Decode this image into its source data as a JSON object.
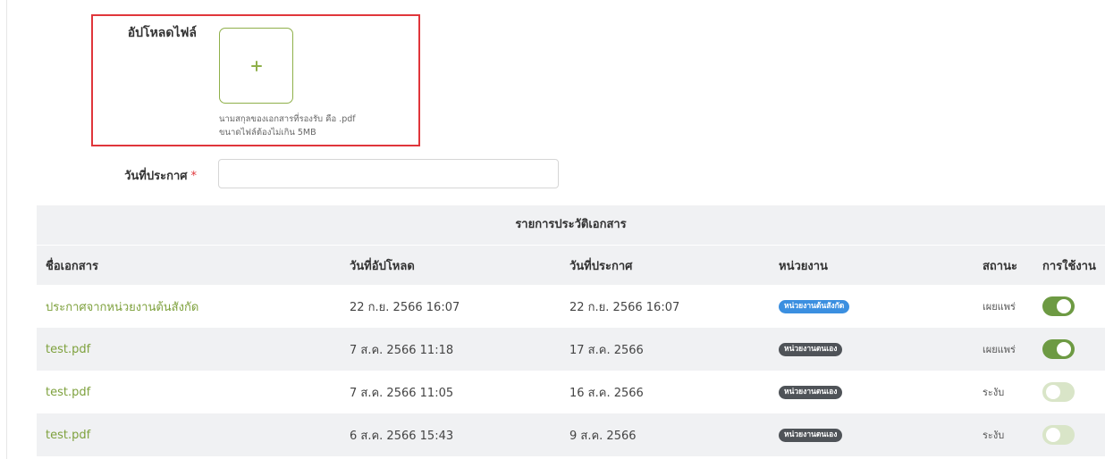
{
  "upload": {
    "label": "อัปโหลดไฟล์",
    "hint_line1": "นามสกุลของเอกสารที่รองรับ คือ .pdf",
    "hint_line2": "ขนาดไฟล์ต้องไม่เกิน 5MB",
    "icon": "plus-icon"
  },
  "announce_date": {
    "label": "วันที่ประกาศ",
    "required_mark": "*",
    "value": "",
    "placeholder": ""
  },
  "history_table": {
    "title": "รายการประวัติเอกสาร",
    "columns": [
      "ชื่อเอกสาร",
      "วันที่อัปโหลด",
      "วันที่ประกาศ",
      "หน่วยงาน",
      "สถานะ",
      "การใช้งาน"
    ],
    "rows": [
      {
        "name": "ประกาศจากหน่วยงานต้นสังกัด",
        "uploaded": "22 ก.ย. 2566 16:07",
        "announced": "22 ก.ย. 2566 16:07",
        "unit": "หน่วยงานต้นสังกัด",
        "unit_color": "#3b8fe0",
        "status": "เผยแพร่",
        "enabled": true
      },
      {
        "name": "test.pdf",
        "uploaded": "7 ส.ค. 2566 11:18",
        "announced": "17 ส.ค. 2566",
        "unit": "หน่วยงานตนเอง",
        "unit_color": "#4f5358",
        "status": "เผยแพร่",
        "enabled": true
      },
      {
        "name": "test.pdf",
        "uploaded": "7 ส.ค. 2566 11:05",
        "announced": "16 ส.ค. 2566",
        "unit": "หน่วยงานตนเอง",
        "unit_color": "#4f5358",
        "status": "ระงับ",
        "enabled": false
      },
      {
        "name": "test.pdf",
        "uploaded": "6 ส.ค. 2566 15:43",
        "announced": "9 ส.ค. 2566",
        "unit": "หน่วยงานตนเอง",
        "unit_color": "#4f5358",
        "status": "ระงับ",
        "enabled": false
      }
    ]
  },
  "colors": {
    "accent_green": "#7ea13d",
    "toggle_on": "#6d9a43",
    "toggle_off": "#d9e5c8",
    "highlight_red": "#e0363b",
    "table_header_bg": "#f0f1f3"
  }
}
